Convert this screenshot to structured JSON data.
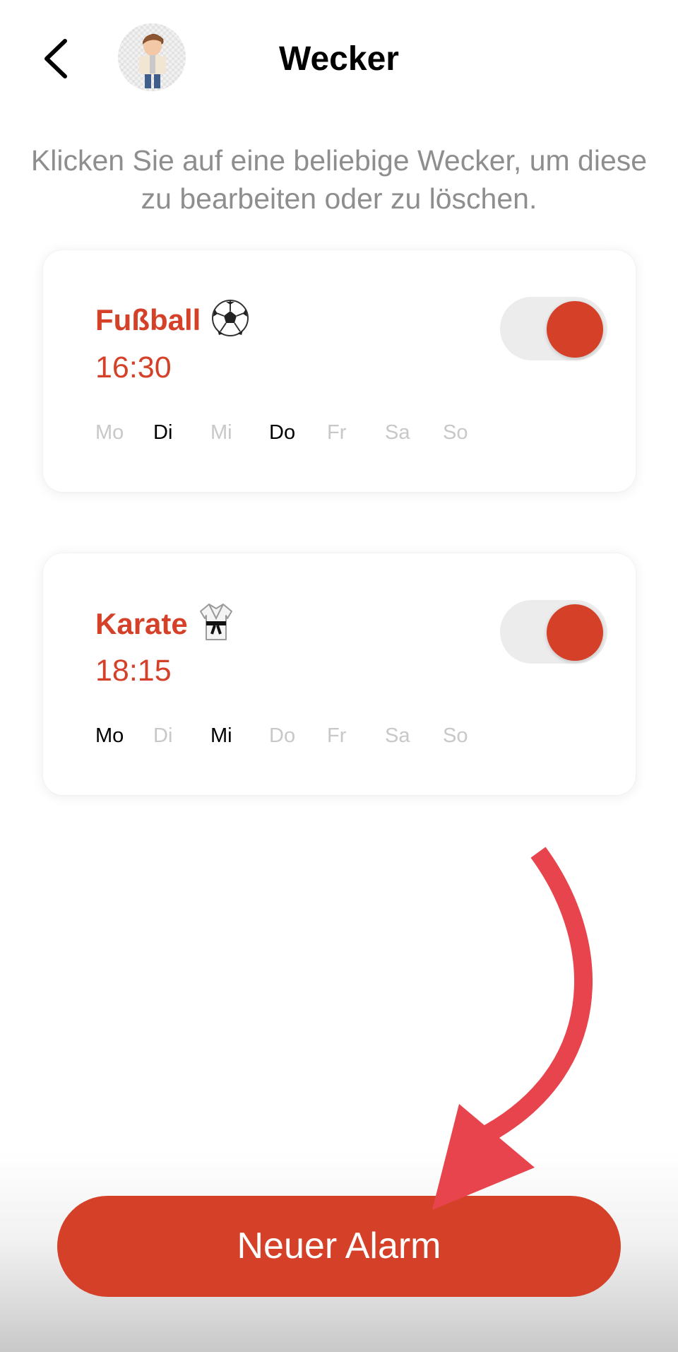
{
  "header": {
    "title": "Wecker",
    "back_icon": "chevron-left-icon",
    "avatar_icon": "avatar-icon"
  },
  "instruction": "Klicken Sie auf eine beliebige Wecker, um diese zu bearbeiten oder zu löschen.",
  "alarms": [
    {
      "name": "Fußball",
      "emoji": "⚽",
      "emoji_icon": "soccer-ball-icon",
      "time": "16:30",
      "enabled": true,
      "days": [
        {
          "label": "Mo",
          "active": false
        },
        {
          "label": "Di",
          "active": true
        },
        {
          "label": "Mi",
          "active": false
        },
        {
          "label": "Do",
          "active": true
        },
        {
          "label": "Fr",
          "active": false
        },
        {
          "label": "Sa",
          "active": false
        },
        {
          "label": "So",
          "active": false
        }
      ]
    },
    {
      "name": "Karate",
      "emoji": "🥋",
      "emoji_icon": "martial-arts-uniform-icon",
      "time": "18:15",
      "enabled": true,
      "days": [
        {
          "label": "Mo",
          "active": true
        },
        {
          "label": "Di",
          "active": false
        },
        {
          "label": "Mi",
          "active": true
        },
        {
          "label": "Do",
          "active": false
        },
        {
          "label": "Fr",
          "active": false
        },
        {
          "label": "Sa",
          "active": false
        },
        {
          "label": "So",
          "active": false
        }
      ]
    }
  ],
  "new_alarm_label": "Neuer Alarm",
  "colors": {
    "accent": "#d54128",
    "annotation_arrow": "#e8444d",
    "muted_text": "#8e8e8e",
    "inactive_day": "#c8c8c8"
  }
}
